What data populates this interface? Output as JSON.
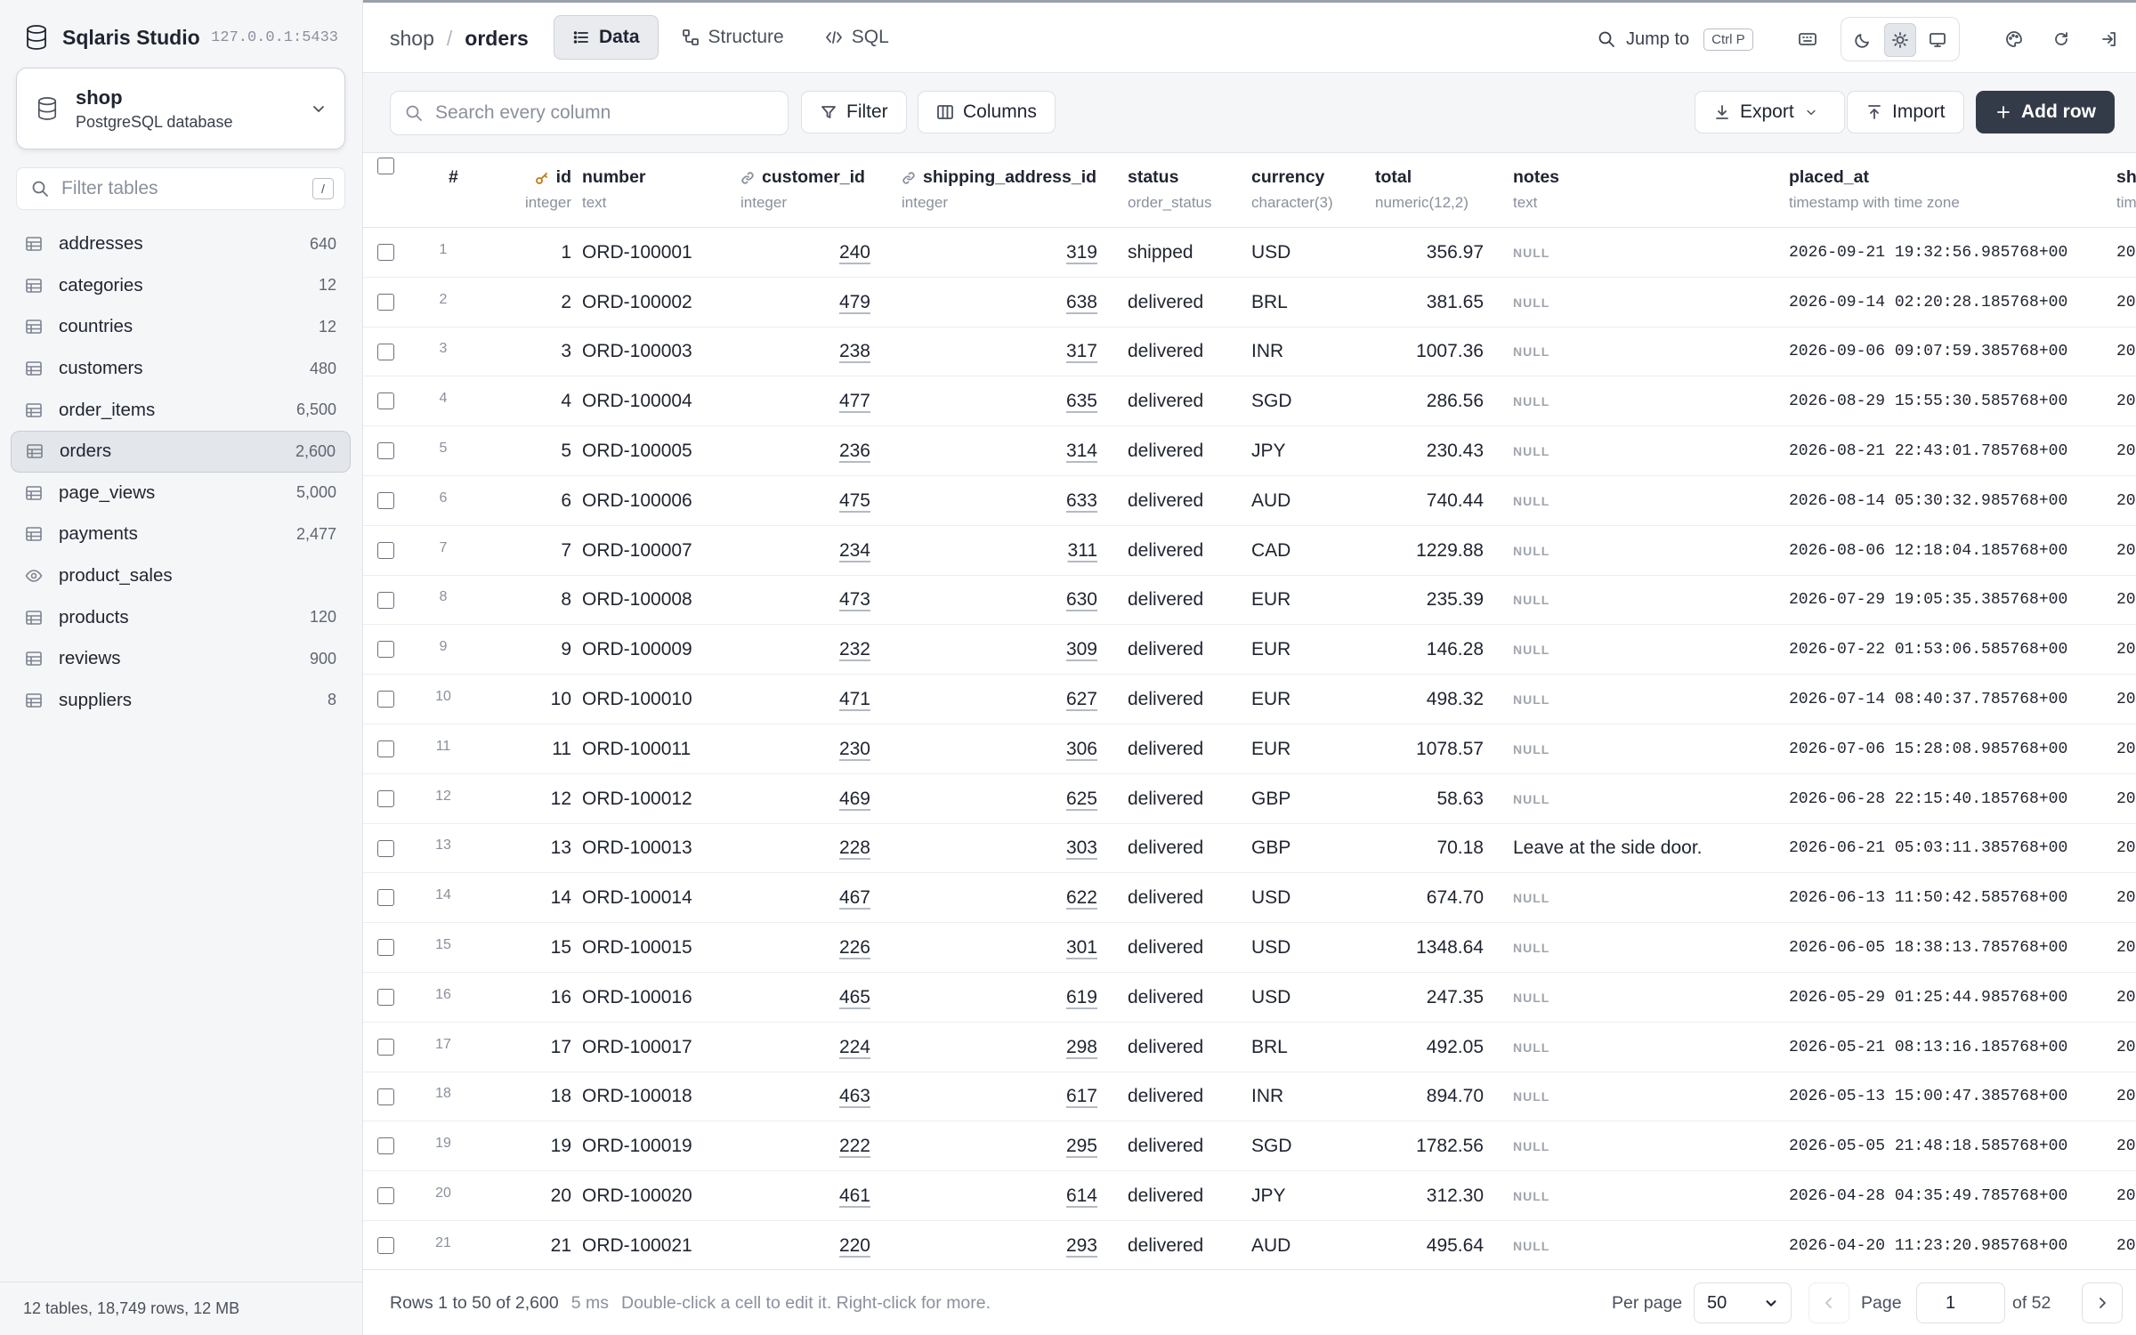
{
  "app": {
    "name": "Sqlaris Studio",
    "host": "127.0.0.1:5433"
  },
  "database": {
    "name": "shop",
    "engine": "PostgreSQL database"
  },
  "table_filter": {
    "placeholder": "Filter tables",
    "shortcut": "/"
  },
  "tables": [
    {
      "name": "addresses",
      "count": "640",
      "kind": "table"
    },
    {
      "name": "categories",
      "count": "12",
      "kind": "table"
    },
    {
      "name": "countries",
      "count": "12",
      "kind": "table"
    },
    {
      "name": "customers",
      "count": "480",
      "kind": "table"
    },
    {
      "name": "order_items",
      "count": "6,500",
      "kind": "table"
    },
    {
      "name": "orders",
      "count": "2,600",
      "kind": "table",
      "active": true
    },
    {
      "name": "page_views",
      "count": "5,000",
      "kind": "table"
    },
    {
      "name": "payments",
      "count": "2,477",
      "kind": "table"
    },
    {
      "name": "product_sales",
      "count": "",
      "kind": "view"
    },
    {
      "name": "products",
      "count": "120",
      "kind": "table"
    },
    {
      "name": "reviews",
      "count": "900",
      "kind": "table"
    },
    {
      "name": "suppliers",
      "count": "8",
      "kind": "table"
    }
  ],
  "sidebar_footer": "12 tables, 18,749 rows, 12 MB",
  "breadcrumb": {
    "schema": "shop",
    "sep": "/",
    "table": "orders"
  },
  "view_tabs": [
    {
      "label": "Data",
      "icon": "list-icon",
      "active": true
    },
    {
      "label": "Structure",
      "icon": "structure-icon"
    },
    {
      "label": "SQL",
      "icon": "code-icon"
    }
  ],
  "jump": {
    "label": "Jump to",
    "shortcut": "Ctrl P"
  },
  "toolbar": {
    "search_placeholder": "Search every column",
    "filter": "Filter",
    "columns": "Columns",
    "export": "Export",
    "import": "Import",
    "add_row": "Add row"
  },
  "columns": [
    {
      "name": "#",
      "type": ""
    },
    {
      "name": "id",
      "type": "integer",
      "key": "primary"
    },
    {
      "name": "number",
      "type": "text"
    },
    {
      "name": "customer_id",
      "type": "integer",
      "key": "foreign"
    },
    {
      "name": "shipping_address_id",
      "type": "integer",
      "key": "foreign"
    },
    {
      "name": "status",
      "type": "order_status"
    },
    {
      "name": "currency",
      "type": "character(3)"
    },
    {
      "name": "total",
      "type": "numeric(12,2)"
    },
    {
      "name": "notes",
      "type": "text"
    },
    {
      "name": "placed_at",
      "type": "timestamp with time zone"
    },
    {
      "name": "sh",
      "type": "tim"
    }
  ],
  "rows": [
    {
      "rn": "1",
      "id": "1",
      "number": "ORD-100001",
      "customer_id": "240",
      "shipping_address_id": "319",
      "status": "shipped",
      "currency": "USD",
      "total": "356.97",
      "notes": "NULL",
      "placed_at": "2026-09-21 19:32:56.985768+00",
      "next": "20"
    },
    {
      "rn": "2",
      "id": "2",
      "number": "ORD-100002",
      "customer_id": "479",
      "shipping_address_id": "638",
      "status": "delivered",
      "currency": "BRL",
      "total": "381.65",
      "notes": "NULL",
      "placed_at": "2026-09-14 02:20:28.185768+00",
      "next": "20"
    },
    {
      "rn": "3",
      "id": "3",
      "number": "ORD-100003",
      "customer_id": "238",
      "shipping_address_id": "317",
      "status": "delivered",
      "currency": "INR",
      "total": "1007.36",
      "notes": "NULL",
      "placed_at": "2026-09-06 09:07:59.385768+00",
      "next": "20"
    },
    {
      "rn": "4",
      "id": "4",
      "number": "ORD-100004",
      "customer_id": "477",
      "shipping_address_id": "635",
      "status": "delivered",
      "currency": "SGD",
      "total": "286.56",
      "notes": "NULL",
      "placed_at": "2026-08-29 15:55:30.585768+00",
      "next": "20"
    },
    {
      "rn": "5",
      "id": "5",
      "number": "ORD-100005",
      "customer_id": "236",
      "shipping_address_id": "314",
      "status": "delivered",
      "currency": "JPY",
      "total": "230.43",
      "notes": "NULL",
      "placed_at": "2026-08-21 22:43:01.785768+00",
      "next": "20"
    },
    {
      "rn": "6",
      "id": "6",
      "number": "ORD-100006",
      "customer_id": "475",
      "shipping_address_id": "633",
      "status": "delivered",
      "currency": "AUD",
      "total": "740.44",
      "notes": "NULL",
      "placed_at": "2026-08-14 05:30:32.985768+00",
      "next": "20"
    },
    {
      "rn": "7",
      "id": "7",
      "number": "ORD-100007",
      "customer_id": "234",
      "shipping_address_id": "311",
      "status": "delivered",
      "currency": "CAD",
      "total": "1229.88",
      "notes": "NULL",
      "placed_at": "2026-08-06 12:18:04.185768+00",
      "next": "20"
    },
    {
      "rn": "8",
      "id": "8",
      "number": "ORD-100008",
      "customer_id": "473",
      "shipping_address_id": "630",
      "status": "delivered",
      "currency": "EUR",
      "total": "235.39",
      "notes": "NULL",
      "placed_at": "2026-07-29 19:05:35.385768+00",
      "next": "20"
    },
    {
      "rn": "9",
      "id": "9",
      "number": "ORD-100009",
      "customer_id": "232",
      "shipping_address_id": "309",
      "status": "delivered",
      "currency": "EUR",
      "total": "146.28",
      "notes": "NULL",
      "placed_at": "2026-07-22 01:53:06.585768+00",
      "next": "20"
    },
    {
      "rn": "10",
      "id": "10",
      "number": "ORD-100010",
      "customer_id": "471",
      "shipping_address_id": "627",
      "status": "delivered",
      "currency": "EUR",
      "total": "498.32",
      "notes": "NULL",
      "placed_at": "2026-07-14 08:40:37.785768+00",
      "next": "20"
    },
    {
      "rn": "11",
      "id": "11",
      "number": "ORD-100011",
      "customer_id": "230",
      "shipping_address_id": "306",
      "status": "delivered",
      "currency": "EUR",
      "total": "1078.57",
      "notes": "NULL",
      "placed_at": "2026-07-06 15:28:08.985768+00",
      "next": "20"
    },
    {
      "rn": "12",
      "id": "12",
      "number": "ORD-100012",
      "customer_id": "469",
      "shipping_address_id": "625",
      "status": "delivered",
      "currency": "GBP",
      "total": "58.63",
      "notes": "NULL",
      "placed_at": "2026-06-28 22:15:40.185768+00",
      "next": "20"
    },
    {
      "rn": "13",
      "id": "13",
      "number": "ORD-100013",
      "customer_id": "228",
      "shipping_address_id": "303",
      "status": "delivered",
      "currency": "GBP",
      "total": "70.18",
      "notes": "Leave at the side door.",
      "placed_at": "2026-06-21 05:03:11.385768+00",
      "next": "20"
    },
    {
      "rn": "14",
      "id": "14",
      "number": "ORD-100014",
      "customer_id": "467",
      "shipping_address_id": "622",
      "status": "delivered",
      "currency": "USD",
      "total": "674.70",
      "notes": "NULL",
      "placed_at": "2026-06-13 11:50:42.585768+00",
      "next": "20"
    },
    {
      "rn": "15",
      "id": "15",
      "number": "ORD-100015",
      "customer_id": "226",
      "shipping_address_id": "301",
      "status": "delivered",
      "currency": "USD",
      "total": "1348.64",
      "notes": "NULL",
      "placed_at": "2026-06-05 18:38:13.785768+00",
      "next": "20"
    },
    {
      "rn": "16",
      "id": "16",
      "number": "ORD-100016",
      "customer_id": "465",
      "shipping_address_id": "619",
      "status": "delivered",
      "currency": "USD",
      "total": "247.35",
      "notes": "NULL",
      "placed_at": "2026-05-29 01:25:44.985768+00",
      "next": "20"
    },
    {
      "rn": "17",
      "id": "17",
      "number": "ORD-100017",
      "customer_id": "224",
      "shipping_address_id": "298",
      "status": "delivered",
      "currency": "BRL",
      "total": "492.05",
      "notes": "NULL",
      "placed_at": "2026-05-21 08:13:16.185768+00",
      "next": "20"
    },
    {
      "rn": "18",
      "id": "18",
      "number": "ORD-100018",
      "customer_id": "463",
      "shipping_address_id": "617",
      "status": "delivered",
      "currency": "INR",
      "total": "894.70",
      "notes": "NULL",
      "placed_at": "2026-05-13 15:00:47.385768+00",
      "next": "20"
    },
    {
      "rn": "19",
      "id": "19",
      "number": "ORD-100019",
      "customer_id": "222",
      "shipping_address_id": "295",
      "status": "delivered",
      "currency": "SGD",
      "total": "1782.56",
      "notes": "NULL",
      "placed_at": "2026-05-05 21:48:18.585768+00",
      "next": "20"
    },
    {
      "rn": "20",
      "id": "20",
      "number": "ORD-100020",
      "customer_id": "461",
      "shipping_address_id": "614",
      "status": "delivered",
      "currency": "JPY",
      "total": "312.30",
      "notes": "NULL",
      "placed_at": "2026-04-28 04:35:49.785768+00",
      "next": "20"
    },
    {
      "rn": "21",
      "id": "21",
      "number": "ORD-100021",
      "customer_id": "220",
      "shipping_address_id": "293",
      "status": "delivered",
      "currency": "AUD",
      "total": "495.64",
      "notes": "NULL",
      "placed_at": "2026-04-20 11:23:20.985768+00",
      "next": "20"
    }
  ],
  "footer": {
    "range": "Rows 1 to 50 of 2,600",
    "timing": "5 ms",
    "hint": "Double-click a cell to edit it. Right-click for more.",
    "per_page_label": "Per page",
    "per_page_value": "50",
    "page_label": "Page",
    "page_value": "1",
    "page_total": "of 52"
  },
  "colors": {
    "accent": "#343b48",
    "sidebar_bg": "#f5f6f8",
    "toolbar_bg": "#f5f6f8",
    "muted": "#8a909c"
  }
}
